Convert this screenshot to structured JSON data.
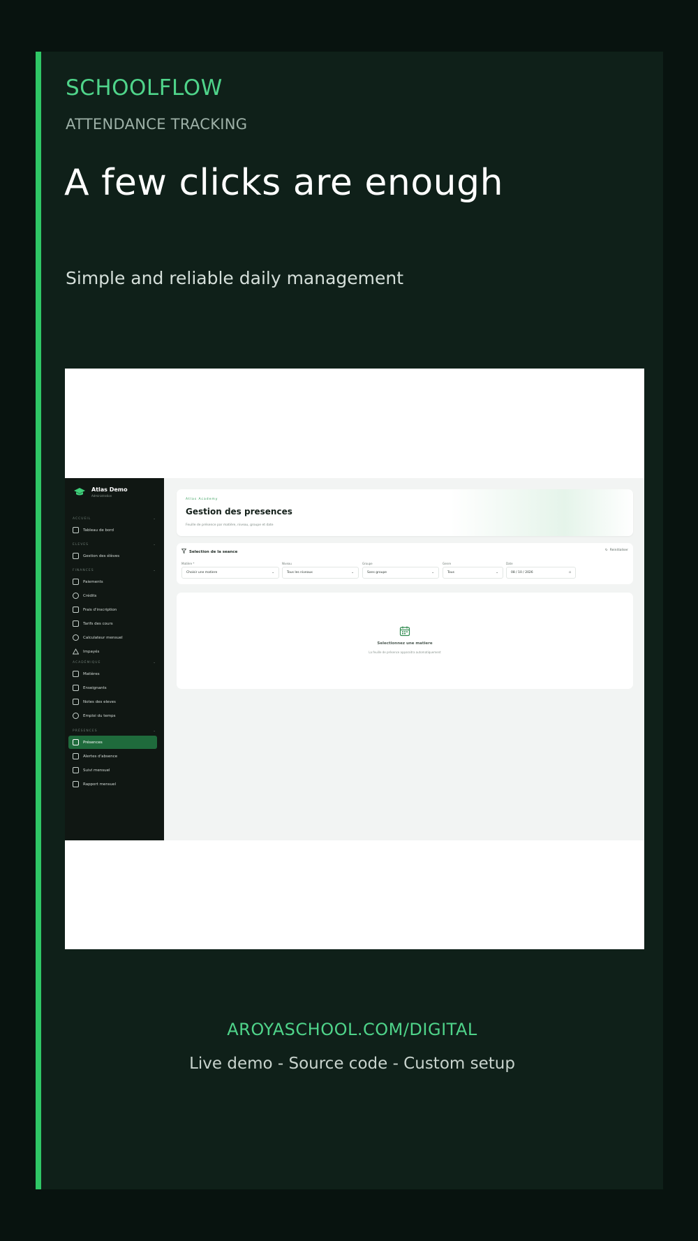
{
  "brand": "SCHOOLFLOW",
  "eyebrow": "ATTENDANCE TRACKING",
  "headline": "A few clicks are enough",
  "subline": "Simple and reliable daily management",
  "colors": {
    "accent": "#2fc766",
    "brand_text": "#4fd48a",
    "background": "#0f2019",
    "sidebar": "#101713",
    "active_item": "#1f6b3c"
  },
  "app": {
    "sidebar": {
      "title": "Atlas Demo",
      "subtitle": "Administration",
      "sections": [
        {
          "label": "ACCUEIL",
          "items": [
            {
              "label": "Tableau de bord",
              "icon": "grid-icon"
            }
          ]
        },
        {
          "label": "ELEVES",
          "items": [
            {
              "label": "Gestion des élèves",
              "icon": "users-icon"
            }
          ]
        },
        {
          "label": "FINANCES",
          "items": [
            {
              "label": "Paiements",
              "icon": "card-icon"
            },
            {
              "label": "Crédits",
              "icon": "coin-icon"
            },
            {
              "label": "Frais d'inscription",
              "icon": "clipboard-icon"
            },
            {
              "label": "Tarifs des cours",
              "icon": "receipt-icon"
            },
            {
              "label": "Calculateur mensuel",
              "icon": "dollar-icon"
            },
            {
              "label": "Impayés",
              "icon": "alert-icon"
            }
          ]
        },
        {
          "label": "ACADÉMIQUE",
          "items": [
            {
              "label": "Matières",
              "icon": "book-icon"
            },
            {
              "label": "Enseignants",
              "icon": "graduation-icon"
            },
            {
              "label": "Notes des eleves",
              "icon": "note-icon"
            },
            {
              "label": "Emploi du temps",
              "icon": "clock-icon"
            }
          ]
        },
        {
          "label": "PRÉSENCES",
          "items": [
            {
              "label": "Présences",
              "icon": "calendar-icon",
              "active": true
            },
            {
              "label": "Alertes d'absence",
              "icon": "chart-icon"
            },
            {
              "label": "Suivi mensuel",
              "icon": "clipboard-icon"
            },
            {
              "label": "Rapport mensuel",
              "icon": "report-icon"
            }
          ]
        }
      ]
    },
    "hero": {
      "kicker": "Atlas Academy",
      "title": "Gestion des presences",
      "description": "Feuille de présence par matière, niveau, groupe et date"
    },
    "filters": {
      "title": "Selection de la seance",
      "reset_label": "Reinitialiser",
      "fields": [
        {
          "label": "Matière *",
          "value": "Choisir une matiere"
        },
        {
          "label": "Niveau",
          "value": "Tous les niveaux"
        },
        {
          "label": "Groupe",
          "value": "Sans groupe"
        },
        {
          "label": "Genre",
          "value": "Tous"
        },
        {
          "label": "Date",
          "value": "08 / 10 / 2026"
        }
      ]
    },
    "empty_state": {
      "title": "Selectionnez une matiere",
      "description": "La feuille de présence apparaitra automatiquement"
    }
  },
  "footer": {
    "url": "AROYASCHOOL.COM/DIGITAL",
    "tagline": "Live demo - Source code - Custom setup"
  }
}
